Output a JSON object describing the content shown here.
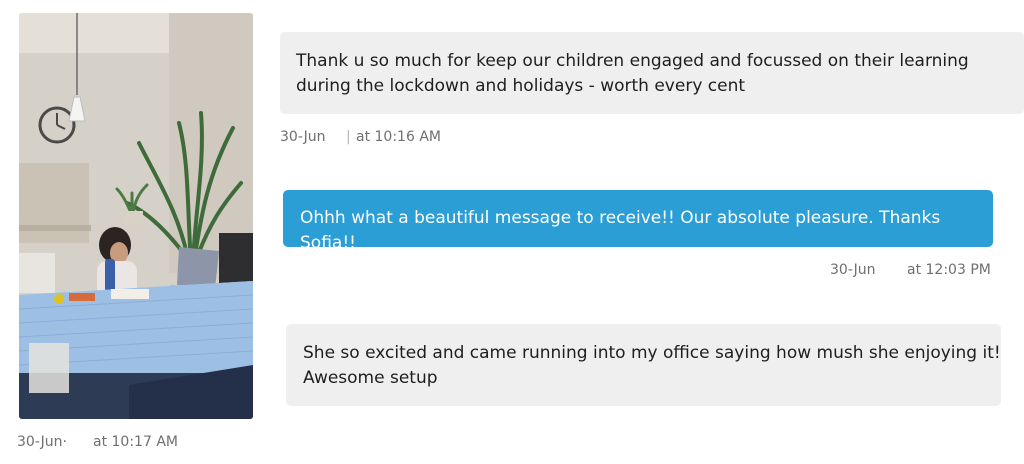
{
  "messages": [
    {
      "text": "Thank u so much for keep our children engaged and focussed on their learning during the lockdown and holidays - worth every cent",
      "date": "30-Jun",
      "separator": "|",
      "time": "at 10:16 AM"
    },
    {
      "text": "Ohhh what a beautiful message to receive!! Our absolute pleasure. Thanks Sofia!!",
      "date": "30-Jun",
      "time": "at 12:03 PM"
    },
    {
      "text": "She so excited and came running into my office saying how mush she enjoying it! Awesome setup"
    }
  ],
  "photo": {
    "date": "30-Jun·",
    "time": "at 10:17 AM"
  },
  "colors": {
    "incoming_bubble": "#efefef",
    "outgoing_bubble": "#2b9ed6",
    "meta_text": "#6f6f6f"
  }
}
